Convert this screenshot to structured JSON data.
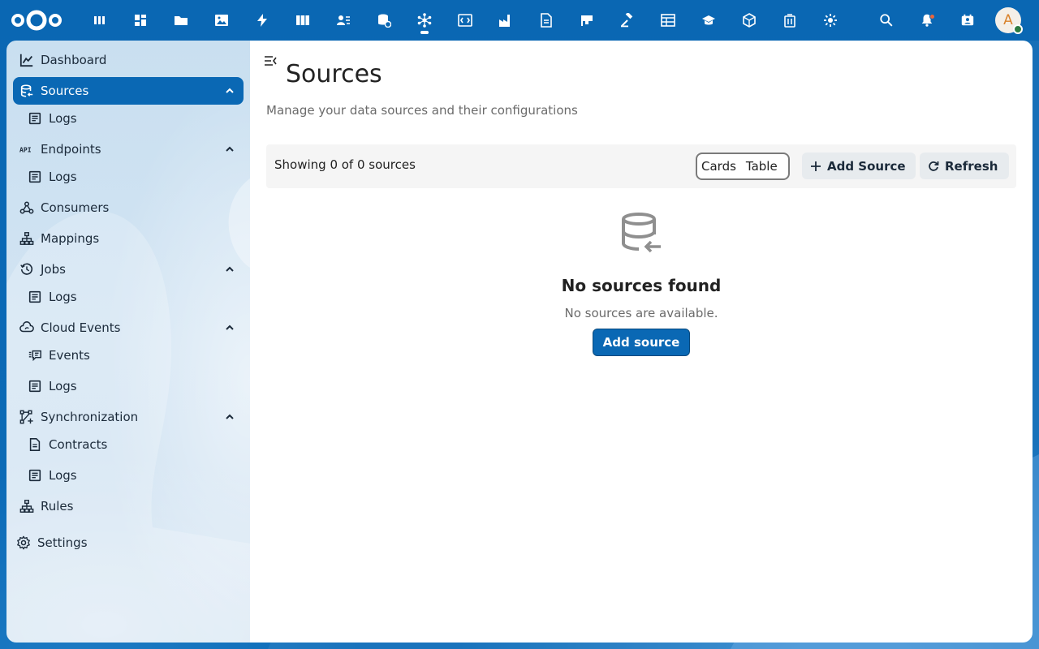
{
  "header": {
    "app_icons": [
      "apps-icon",
      "dashboard-icon",
      "files-icon",
      "photos-icon",
      "activity-icon",
      "deck-icon",
      "contacts-icon",
      "database-sync-icon",
      "integrations-icon",
      "code-icon",
      "factory-icon",
      "document-icon",
      "flag-icon",
      "gavel-icon",
      "table-icon",
      "education-icon",
      "package-icon",
      "trash-icon",
      "settings-gear-icon"
    ],
    "active_app_index": 8,
    "avatar_initial": "A"
  },
  "sidebar": {
    "items": [
      {
        "label": "Dashboard",
        "icon": "chart-line-icon"
      },
      {
        "label": "Sources",
        "icon": "database-icon"
      },
      {
        "label": "Logs",
        "icon": "log-icon"
      },
      {
        "label": "Endpoints",
        "icon": "api-icon"
      },
      {
        "label": "Logs",
        "icon": "log-icon"
      },
      {
        "label": "Consumers",
        "icon": "webhook-icon"
      },
      {
        "label": "Mappings",
        "icon": "sitemap-icon"
      },
      {
        "label": "Jobs",
        "icon": "history-icon"
      },
      {
        "label": "Logs",
        "icon": "log-icon"
      },
      {
        "label": "Cloud Events",
        "icon": "cloud-sync-icon"
      },
      {
        "label": "Events",
        "icon": "message-list-icon"
      },
      {
        "label": "Logs",
        "icon": "log-icon"
      },
      {
        "label": "Synchronization",
        "icon": "vector-polyline-plus-icon"
      },
      {
        "label": "Contracts",
        "icon": "file-document-icon"
      },
      {
        "label": "Logs",
        "icon": "log-icon"
      },
      {
        "label": "Rules",
        "icon": "sitemap-icon"
      },
      {
        "label": "Settings",
        "icon": "cog-icon"
      }
    ]
  },
  "main": {
    "title": "Sources",
    "subtitle": "Manage your data sources and their configurations",
    "showing": "Showing 0 of 0 sources",
    "view_options": [
      "Cards",
      "Table"
    ],
    "add_source_label": "Add Source",
    "refresh_label": "Refresh",
    "empty": {
      "title": "No sources found",
      "description": "No sources are available.",
      "button": "Add source"
    }
  },
  "colors": {
    "primary": "#0a68b4",
    "sidebar_bg": "#cfe1f1",
    "notification_dot": "#e9653b",
    "status_online": "#2d7b41"
  }
}
